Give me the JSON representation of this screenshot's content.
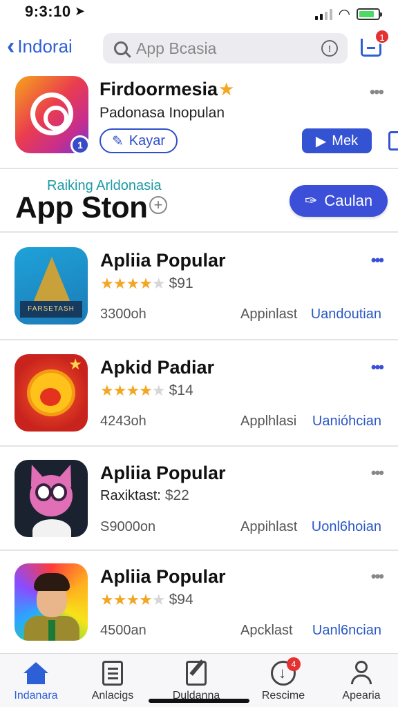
{
  "status_bar": {
    "time": "9:3:10",
    "location_icon": "location-arrow-icon"
  },
  "nav": {
    "back_label": "Indorai",
    "search_placeholder": "App Bcasia",
    "inbox_badge": "1"
  },
  "featured": {
    "title": "Firdoormesia",
    "subtitle": "Padonasa Inopulan",
    "badge": "1",
    "kayar_label": "Kayar",
    "mek_label": "Mek"
  },
  "section": {
    "tag": "Raiking Arldonasia",
    "title": "App Ston",
    "action_label": "Caulan"
  },
  "apps": [
    {
      "name": "Apliia Popular",
      "rating": 4,
      "price": "$91",
      "count": "3300oh",
      "meta": "Appinlast",
      "link": "Uandoutian",
      "more_color": "#3b4fd8"
    },
    {
      "name": "Apkid Padiar",
      "rating": 4,
      "price": "$14",
      "count": "4243oh",
      "meta": "Applhlasi",
      "link": "Uanióhcian",
      "more_color": "#3b4fd8"
    },
    {
      "name": "Apliia Popular",
      "rating_text": "Raxiktast:",
      "price": "$22",
      "count": "S9000on",
      "meta": "Appihlast",
      "link": "Uonl6hoian",
      "more_color": "#888888"
    },
    {
      "name": "Apliia Popular",
      "rating": 4,
      "price": "$94",
      "count": "4500an",
      "meta": "Apcklast",
      "link": "Uanl6ncian",
      "more_color": "#888888"
    }
  ],
  "app1_icon_text": "FARSETASH",
  "tabs": [
    {
      "label": "Indanara",
      "icon": "home-icon",
      "active": true
    },
    {
      "label": "Anlacigs",
      "icon": "list-icon"
    },
    {
      "label": "Duldanna",
      "icon": "edit-icon"
    },
    {
      "label": "Rescime",
      "icon": "download-icon",
      "badge": "4"
    },
    {
      "label": "Apearia",
      "icon": "person-icon"
    }
  ],
  "colors": {
    "accent": "#2d5fd6",
    "button": "#3b4fd8",
    "star": "#f3a623",
    "badge": "#e43131"
  }
}
